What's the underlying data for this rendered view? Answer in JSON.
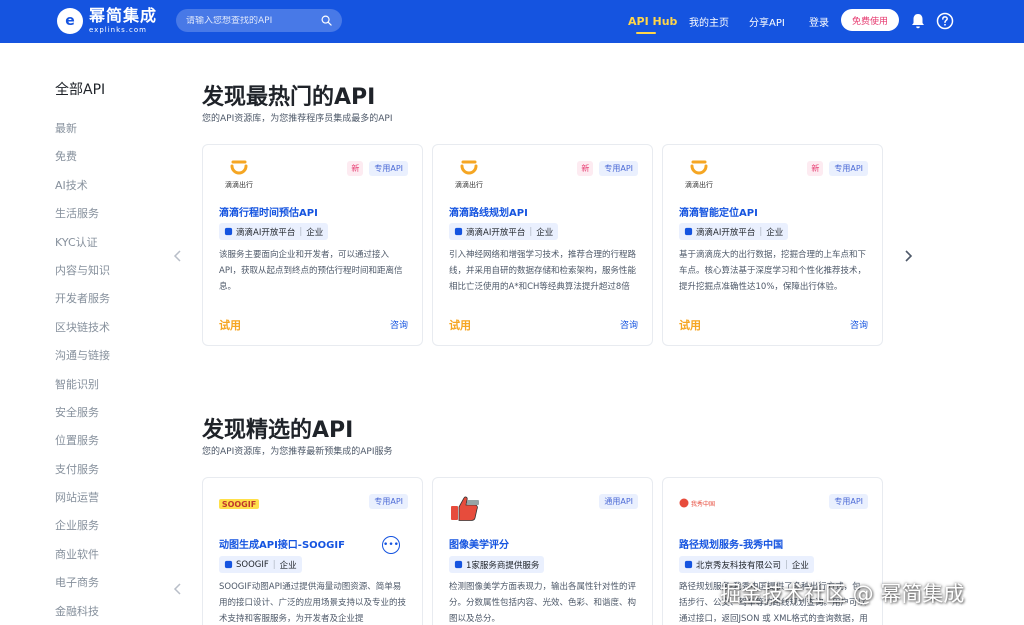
{
  "header": {
    "logo_name": "幂简集成",
    "logo_domain": "explinks.com",
    "search_placeholder": "请输入您想查找的API",
    "nav": {
      "hub": "API Hub",
      "home": "我的主页",
      "share": "分享API",
      "login": "登录",
      "free": "免费使用"
    }
  },
  "sidebar": {
    "title": "全部API",
    "items": [
      "最新",
      "免费",
      "AI技术",
      "生活服务",
      "KYC认证",
      "内容与知识",
      "开发者服务",
      "区块链技术",
      "沟通与链接",
      "智能识别",
      "安全服务",
      "位置服务",
      "支付服务",
      "网站运营",
      "企业服务",
      "商业软件",
      "电子商务",
      "金融科技"
    ]
  },
  "hot": {
    "title": "发现最热门的API",
    "subtitle": "您的API资源库，为您推荐程序员集成最多的API",
    "cards": [
      {
        "logo_text": "滴滴出行",
        "tag_new": "新",
        "tag_type": "专用API",
        "title": "滴滴行程时间预估API",
        "provider": "滴滴AI开放平台",
        "provider_kind": "企业",
        "desc": "该服务主要面向企业和开发者，可以通过接入API，获取从起点到终点的预估行程时间和距离信息。",
        "try": "试用",
        "consult": "咨询"
      },
      {
        "logo_text": "滴滴出行",
        "tag_new": "新",
        "tag_type": "专用API",
        "title": "滴滴路线规划API",
        "provider": "滴滴AI开放平台",
        "provider_kind": "企业",
        "desc": "引入神经网络和增强学习技术，推荐合理的行程路线，并采用自研的数据存储和检索架构，服务性能相比亡泛使用的A*和CH等经典算法提升超过8倍",
        "try": "试用",
        "consult": "咨询"
      },
      {
        "logo_text": "滴滴出行",
        "tag_new": "新",
        "tag_type": "专用API",
        "title": "滴滴智能定位API",
        "provider": "滴滴AI开放平台",
        "provider_kind": "企业",
        "desc": "基于滴滴庞大的出行数据，挖掘合理的上车点和下车点。核心算法基于深度学习和个性化推荐技术，提升挖掘点准确性达10%，保障出行体验。",
        "try": "试用",
        "consult": "咨询"
      }
    ]
  },
  "featured": {
    "title": "发现精选的API",
    "subtitle": "您的API资源库，为您推荐最新预集成的API服务",
    "cards": [
      {
        "logo_text": "SOOGIF",
        "tag_type": "专用API",
        "title": "动图生成API接口-SOOGIF",
        "provider": "SOOGIF",
        "provider_kind": "企业",
        "desc": "SOOGIF动图API通过提供海量动图资源、简单易用的接口设计、广泛的应用场景支持以及专业的技术支持和客服服务，为开发者及企业提"
      },
      {
        "tag_type": "通用API",
        "title": "图像美学评分",
        "provider": "1家服务商提供服务",
        "desc": "检测图像美学方面表现力，输出各属性针对性的评分。分数属性包括内容、光效、色彩、和谐度、构图以及总分。"
      },
      {
        "logo_text": "我秀中国",
        "tag_type": "专用API",
        "title": "路径规划服务-我秀中国",
        "provider": "北京秀友科技有限公司",
        "provider_kind": "企业",
        "desc": "路径规划服务-我秀中国提供了多种出行方式，包括步行、公交、驾车等的路线规划查询。用户可以通过接口，返回JSON 或 XML格式的查询数据，用于"
      }
    ]
  },
  "watermark": "掘金技术社区 @ 幂简集成",
  "colors": {
    "header_bg": "#1554e0",
    "hub_active": "#ffd54a",
    "free_btn_text": "#e6396f",
    "card_title": "#1554e0",
    "try_text": "#f5a623"
  }
}
